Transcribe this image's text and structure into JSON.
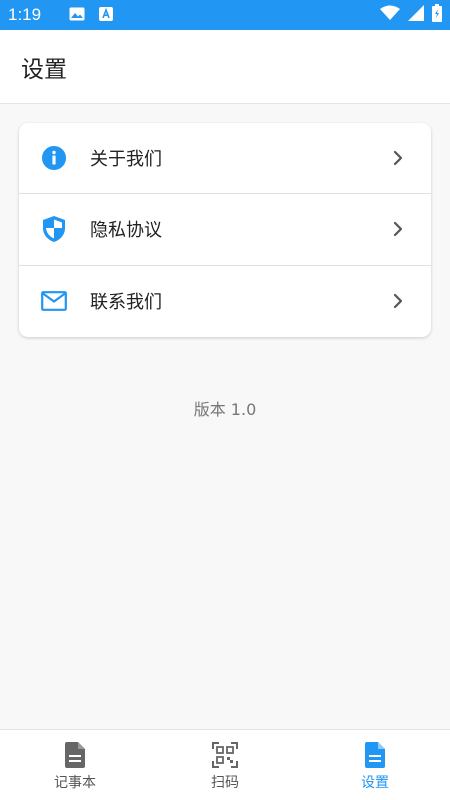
{
  "status_bar": {
    "time": "1:19"
  },
  "app_bar": {
    "title": "设置"
  },
  "menu": {
    "items": [
      {
        "label": "关于我们",
        "icon": "info-icon"
      },
      {
        "label": "隐私协议",
        "icon": "shield-icon"
      },
      {
        "label": "联系我们",
        "icon": "mail-icon"
      }
    ]
  },
  "version_text": "版本 1.0",
  "bottom_nav": {
    "items": [
      {
        "label": "记事本",
        "icon": "document-icon",
        "active": false
      },
      {
        "label": "扫码",
        "icon": "qr-scan-icon",
        "active": false
      },
      {
        "label": "设置",
        "icon": "document-icon",
        "active": true
      }
    ]
  },
  "colors": {
    "accent": "#2196f3",
    "inactive_icon": "#666666"
  }
}
